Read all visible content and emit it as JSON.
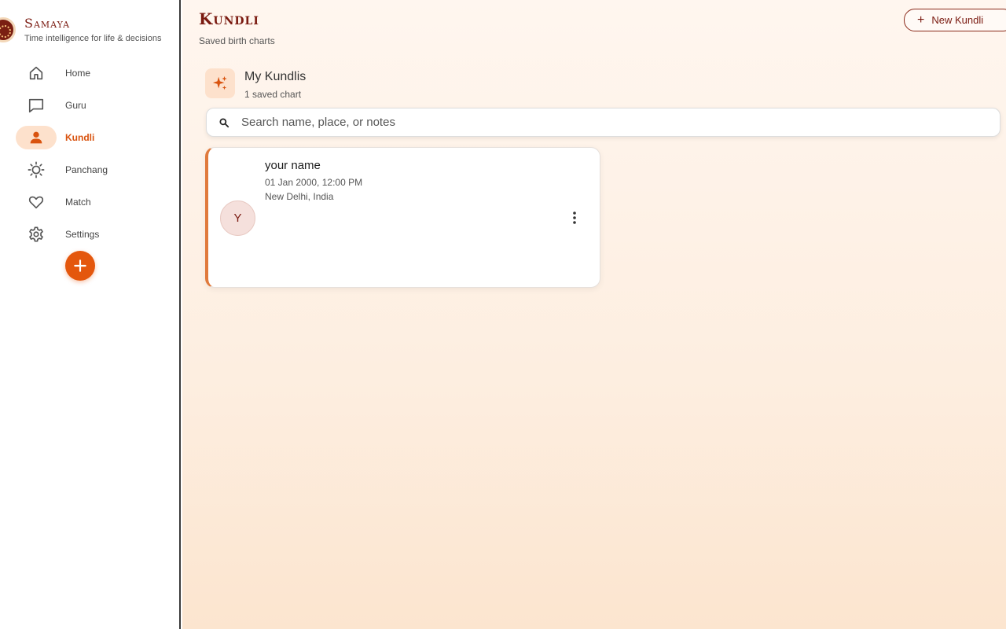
{
  "brand": {
    "name": "Samaya",
    "tagline": "Time intelligence for life & decisions"
  },
  "sidebar": {
    "items": [
      {
        "label": "Home",
        "icon": "home-icon"
      },
      {
        "label": "Guru",
        "icon": "chat-icon"
      },
      {
        "label": "Kundli",
        "icon": "person-icon",
        "active": true
      },
      {
        "label": "Panchang",
        "icon": "sun-icon"
      },
      {
        "label": "Match",
        "icon": "heart-icon"
      },
      {
        "label": "Settings",
        "icon": "gear-icon"
      }
    ],
    "fab_icon": "plus-icon"
  },
  "header": {
    "title": "Kundli",
    "subtitle": "Saved birth charts",
    "new_button_label": "New Kundli"
  },
  "section": {
    "title": "My Kundlis",
    "count_text": "1 saved chart",
    "icon": "sparkles-icon"
  },
  "search": {
    "placeholder": "Search name, place, or notes",
    "value": ""
  },
  "kundlis": [
    {
      "initial": "Y",
      "name": "your name",
      "datetime": "01 Jan 2000, 12:00 PM",
      "place": "New Delhi, India"
    }
  ],
  "colors": {
    "accent": "#e4570d",
    "brand": "#7a1a10",
    "active_bg": "#fde1cc"
  }
}
